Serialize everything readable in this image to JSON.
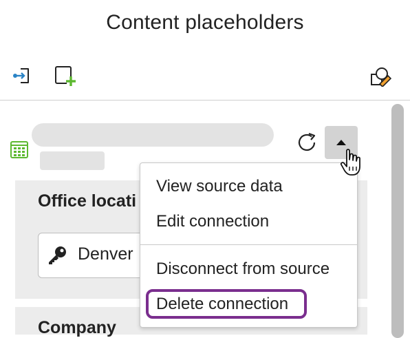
{
  "header": {
    "title": "Content placeholders"
  },
  "toolbar": {
    "icons": [
      "link-connect-icon",
      "add-placeholder-icon",
      "edit-placeholder-icon"
    ],
    "accent_colors": {
      "blue": "#2b84c6",
      "green": "#5cb82f",
      "orange": "#f0a030"
    }
  },
  "placeholder": {
    "table_icon_color": "#5cb82f",
    "fields": [
      {
        "label": "Office locati",
        "value": "Denver"
      },
      {
        "label": "Company"
      }
    ]
  },
  "menu": {
    "items": [
      {
        "label": "View source data"
      },
      {
        "label": "Edit connection"
      },
      {
        "label": "Disconnect from source"
      },
      {
        "label": "Delete connection"
      }
    ],
    "highlight_color": "#7a2e8e"
  }
}
